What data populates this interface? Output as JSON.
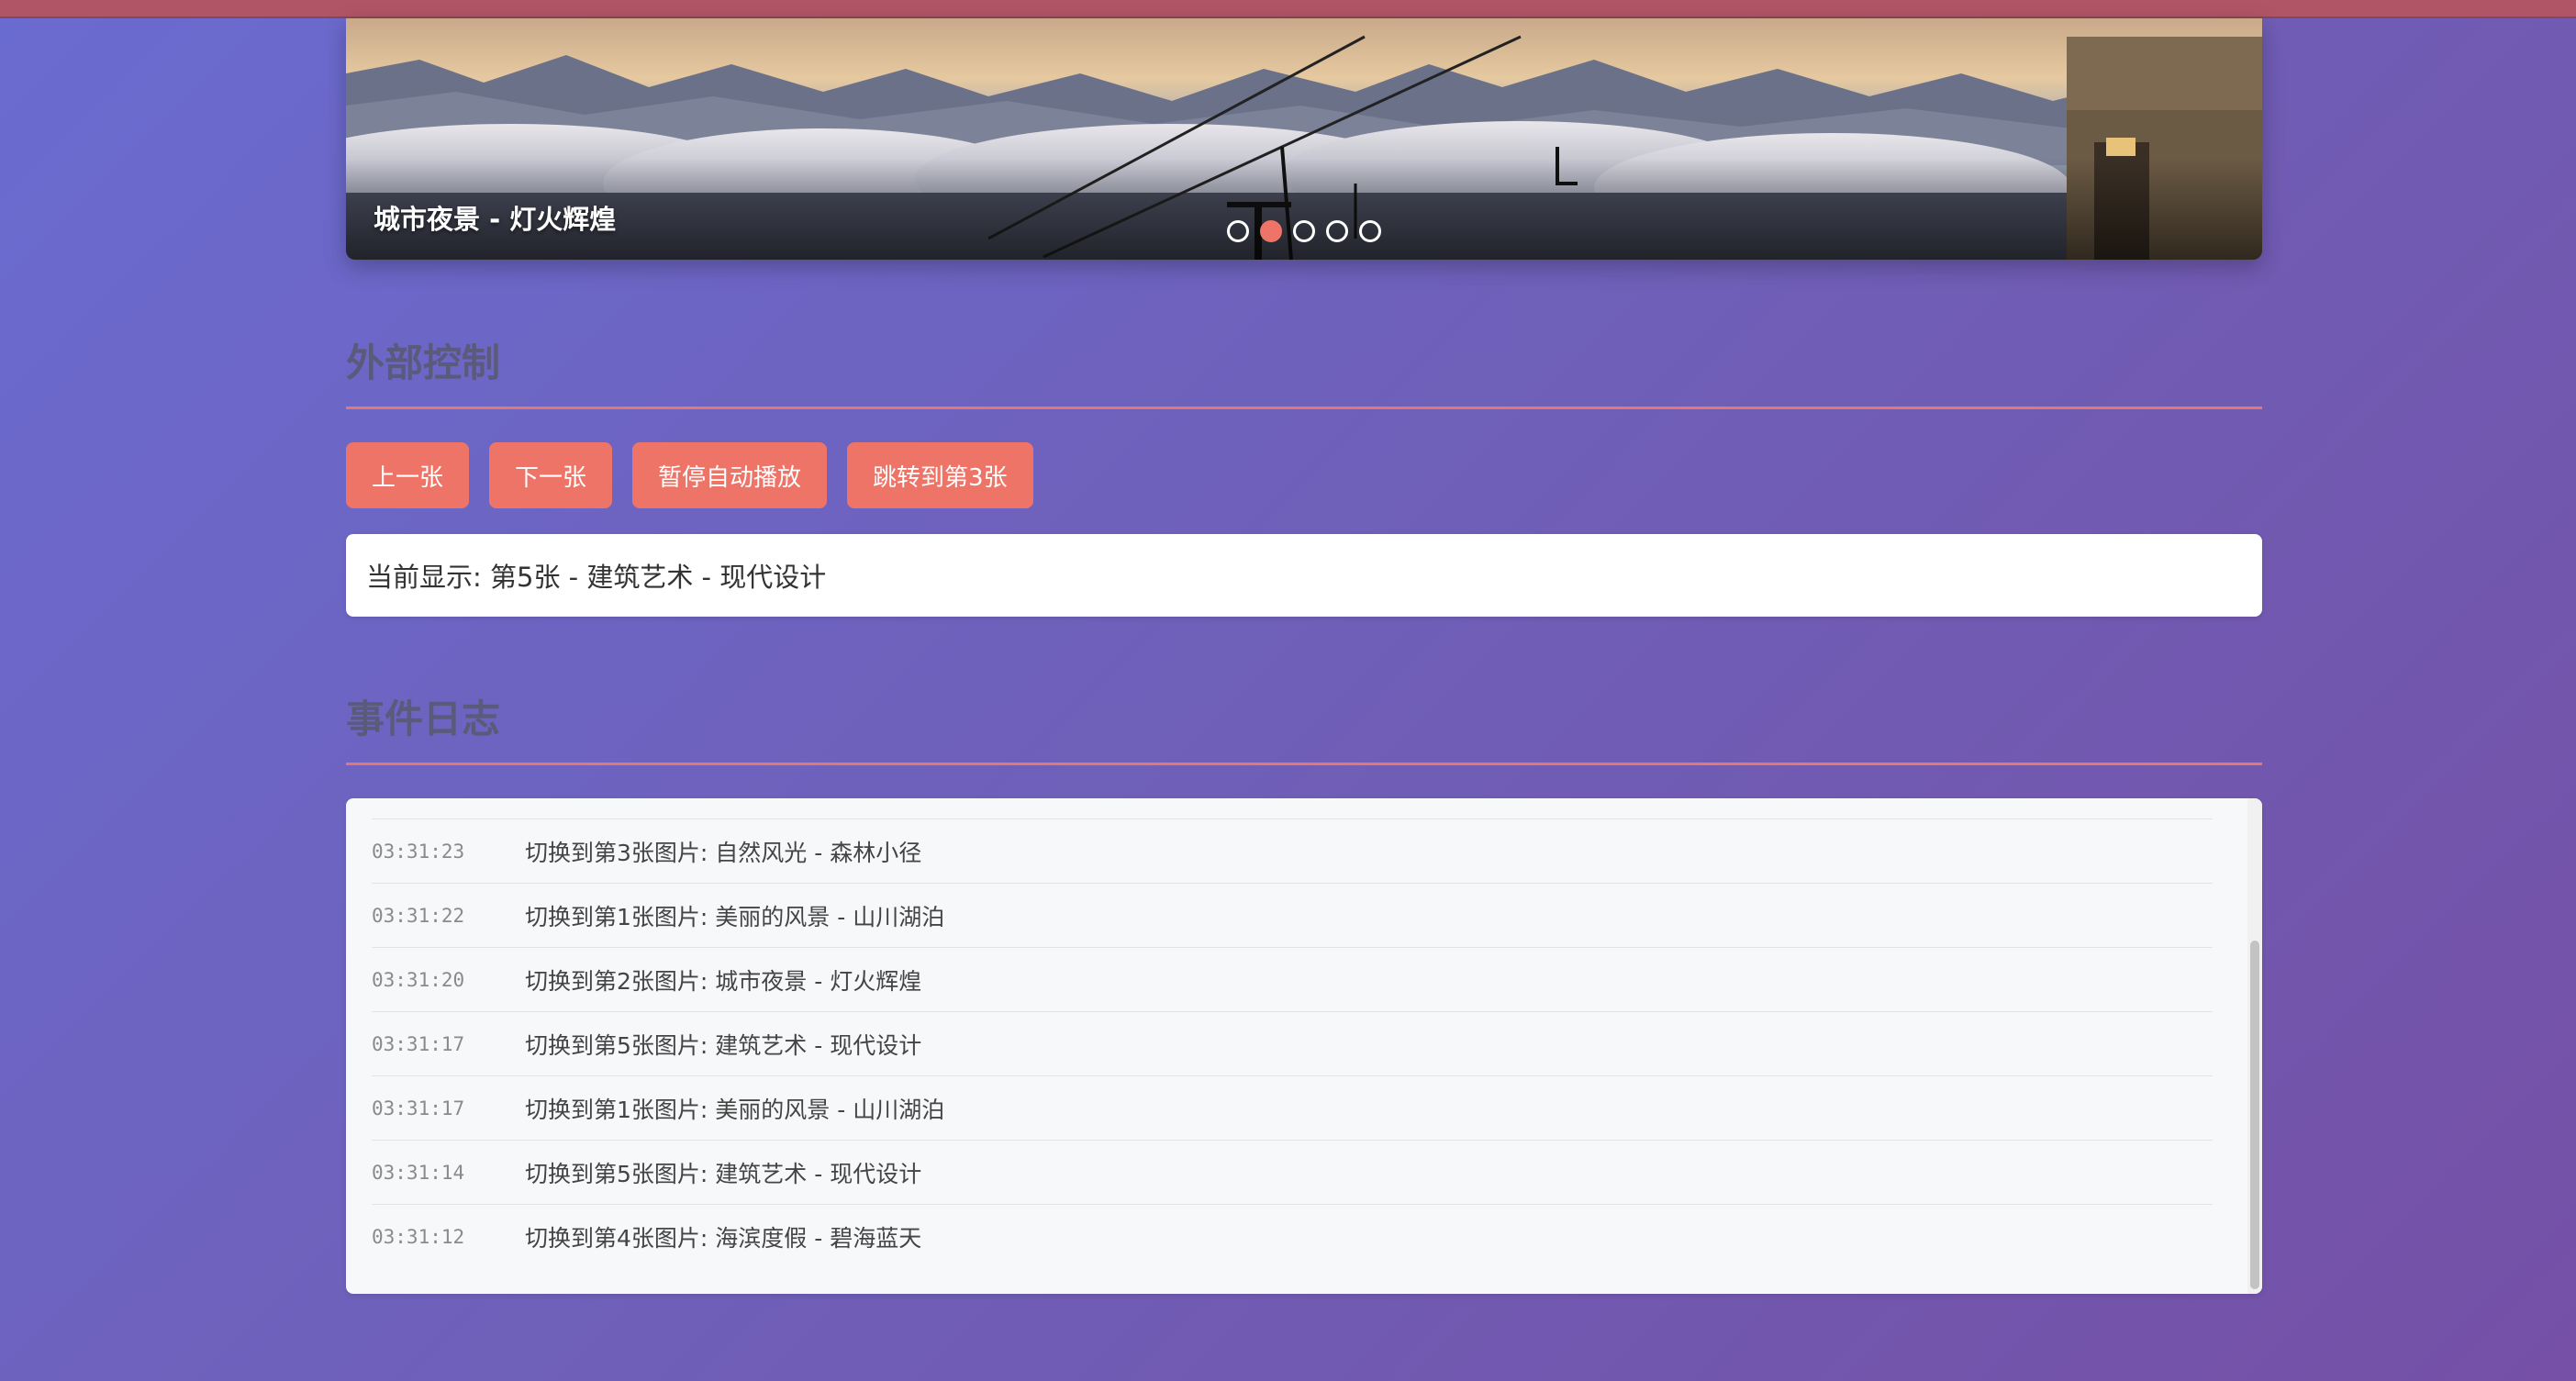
{
  "carousel": {
    "caption": "城市夜景 - 灯火辉煌",
    "dot_count": 5,
    "active_dot_index": 1
  },
  "controls": {
    "title": "外部控制",
    "buttons": {
      "prev": "上一张",
      "next": "下一张",
      "pause": "暂停自动播放",
      "jump": "跳转到第3张"
    },
    "status": "当前显示: 第5张 - 建筑艺术 - 现代设计"
  },
  "log": {
    "title": "事件日志",
    "entries": [
      {
        "time": "03:31:23",
        "message": "切换到第3张图片: 自然风光 - 森林小径"
      },
      {
        "time": "03:31:22",
        "message": "切换到第1张图片: 美丽的风景 - 山川湖泊"
      },
      {
        "time": "03:31:20",
        "message": "切换到第2张图片: 城市夜景 - 灯火辉煌"
      },
      {
        "time": "03:31:17",
        "message": "切换到第5张图片: 建筑艺术 - 现代设计"
      },
      {
        "time": "03:31:17",
        "message": "切换到第1张图片: 美丽的风景 - 山川湖泊"
      },
      {
        "time": "03:31:14",
        "message": "切换到第5张图片: 建筑艺术 - 现代设计"
      },
      {
        "time": "03:31:12",
        "message": "切换到第4张图片: 海滨度假 - 碧海蓝天"
      }
    ]
  },
  "colors": {
    "accent": "#ee7468",
    "background_start": "#6a6bd0",
    "background_end": "#7550a6"
  }
}
